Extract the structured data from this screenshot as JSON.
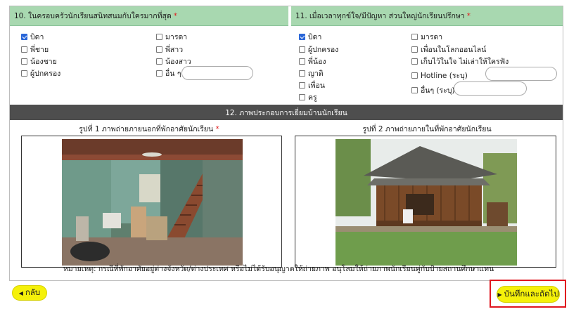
{
  "q10": {
    "title": "10. ในครอบครัวนักเรียนสนิทสนมกับใครมากที่สุด",
    "required_mark": "*",
    "options": [
      {
        "label": "บิดา",
        "checked": true
      },
      {
        "label": "พี่ชาย",
        "checked": false
      },
      {
        "label": "น้องชาย",
        "checked": false
      },
      {
        "label": "ผู้ปกครอง",
        "checked": false
      },
      {
        "label": "มารดา",
        "checked": false
      },
      {
        "label": "พี่สาว",
        "checked": false
      },
      {
        "label": "น้องสาว",
        "checked": false
      },
      {
        "label": "อื่น ๆ",
        "checked": false
      }
    ],
    "other_value": ""
  },
  "q11": {
    "title": "11. เมื่อเวลาทุกข์ใจ/มีปัญหา ส่วนใหญ่นักเรียนปรึกษา",
    "required_mark": "*",
    "options": [
      {
        "label": "บิดา",
        "checked": true
      },
      {
        "label": "ผู้ปกครอง",
        "checked": false
      },
      {
        "label": "พี่น้อง",
        "checked": false
      },
      {
        "label": "ญาติ",
        "checked": false
      },
      {
        "label": "เพื่อน",
        "checked": false
      },
      {
        "label": "ครู",
        "checked": false
      },
      {
        "label": "มารดา",
        "checked": false
      },
      {
        "label": "เพื่อนในโลกออนไลน์",
        "checked": false
      },
      {
        "label": "เก็บไว้ในใจ ไม่เล่าให้ใครฟัง",
        "checked": false
      },
      {
        "label": "Hotline (ระบุ)",
        "checked": false
      },
      {
        "label": "อื่นๆ (ระบุ)",
        "checked": false
      }
    ],
    "hotline_value": "",
    "other_value": ""
  },
  "q12": {
    "title": "12. ภาพประกอบการเยี่ยมบ้านนักเรียน",
    "photo1_caption": "รูปที่ 1 ภาพถ่ายภายนอกที่พักอาศัยนักเรียน",
    "photo1_required": "*",
    "photo2_caption": "รูปที่ 2 ภาพถ่ายภายในที่พักอาศัยนักเรียน",
    "note": "หมายเหตุ: กรณีที่พักอาศัยอยู่ต่างจังหวัด/ต่างประเทศ หรือไม่ได้รับอนุญาตให้ถ่ายภาพ อนุโลมให้ถ่ายภาพนักเรียนคู่กับป้ายสถานศึกษาแทน"
  },
  "nav": {
    "back_label": "กลับ",
    "back_icon": "triangle-left-icon",
    "save_label": "บันทึกและถัดไป",
    "save_icon": "triangle-right-icon"
  },
  "colors": {
    "section_header": "#a8d8b0",
    "divider_bar": "#4e4e4e",
    "button": "#f5f10a",
    "highlight": "#e0161f",
    "checked": "#2a66d8"
  }
}
